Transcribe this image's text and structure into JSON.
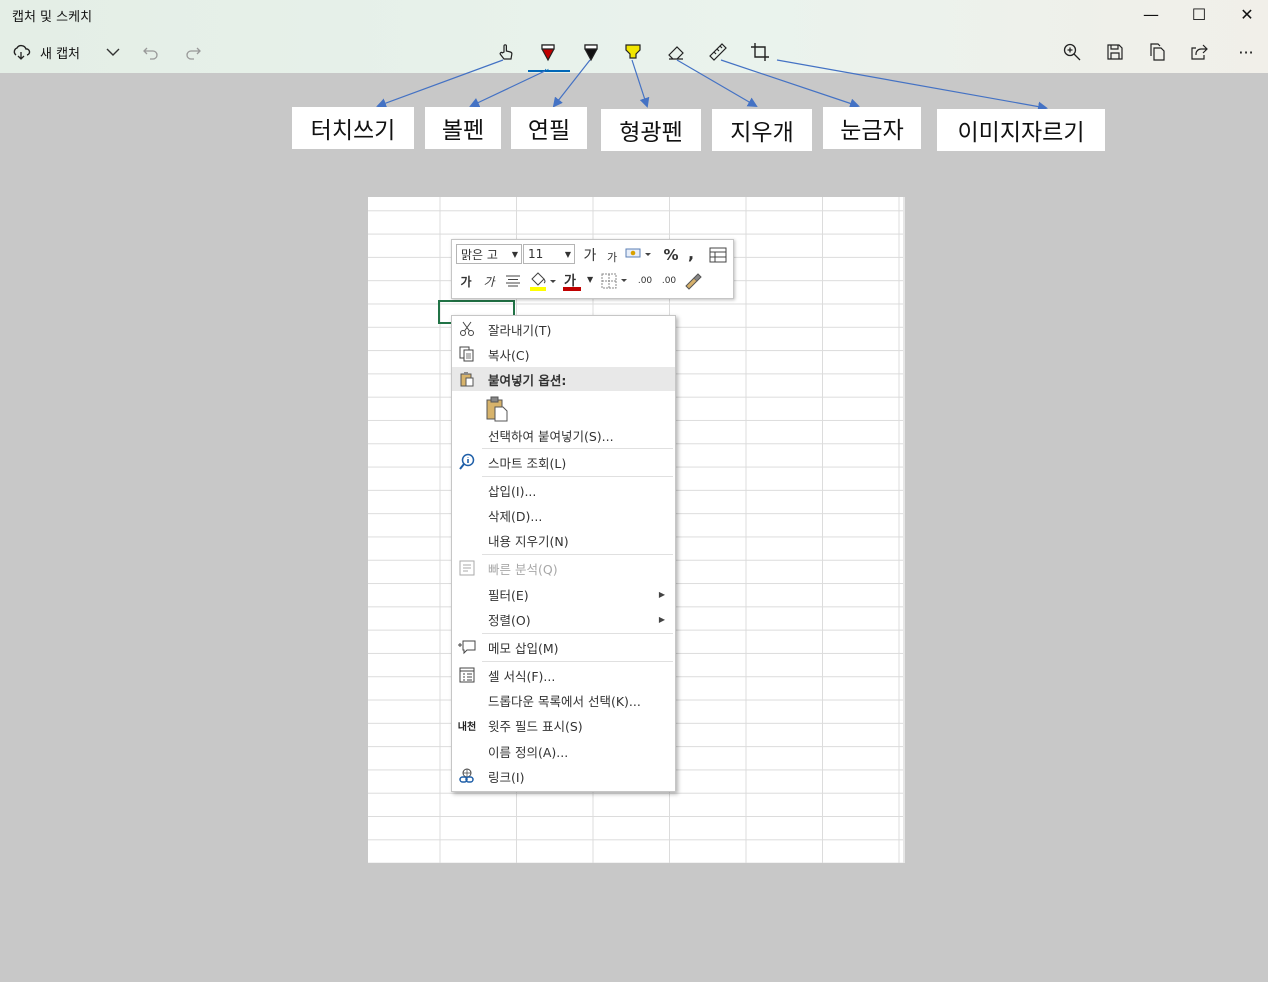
{
  "window": {
    "title": "캡처 및 스케치",
    "minimize": "—",
    "maximize": "☐",
    "close": "✕"
  },
  "toolbar": {
    "new_capture_label": "새 캡처",
    "more_label": "···"
  },
  "tool_labels": {
    "touch": "터치쓰기",
    "ballpoint": "볼펜",
    "pencil": "연필",
    "highlighter": "형광펜",
    "eraser": "지우개",
    "ruler": "눈금자",
    "crop": "이미지자르기"
  },
  "mini_toolbar": {
    "font_name": "맑은 고",
    "font_size": "11",
    "grow_font": "가",
    "shrink_font": "가",
    "percent": "%",
    "comma": ",",
    "bold": "가",
    "italic": "가",
    "font_color_glyph": "가",
    "inc_decimal": ".00",
    "dec_decimal": ".00"
  },
  "context_menu": {
    "cut": "잘라내기(T)",
    "copy": "복사(C)",
    "paste_options": "붙여넣기 옵션:",
    "paste_special": "선택하여 붙여넣기(S)...",
    "smart_lookup": "스마트 조회(L)",
    "insert": "삽입(I)...",
    "delete": "삭제(D)...",
    "clear_contents": "내용 지우기(N)",
    "quick_analysis": "빠른 분석(Q)",
    "filter": "필터(E)",
    "sort": "정렬(O)",
    "insert_comment": "메모 삽입(M)",
    "format_cells": "셀 서식(F)...",
    "pick_from_list": "드롭다운 목록에서 선택(K)...",
    "phonetic": "윗주 필드 표시(S)",
    "define_name": "이름 정의(A)...",
    "link": "링크(I)",
    "phonetic_icon_text": "내천"
  },
  "colors": {
    "toolbar_bg": "#e7f1ea",
    "canvas_bg": "#c8c8c8",
    "accent": "#0067b8",
    "arrow": "#4472c4",
    "pen_red": "#c00000",
    "highlighter_yellow": "#f2e600",
    "active_cell": "#217346"
  }
}
